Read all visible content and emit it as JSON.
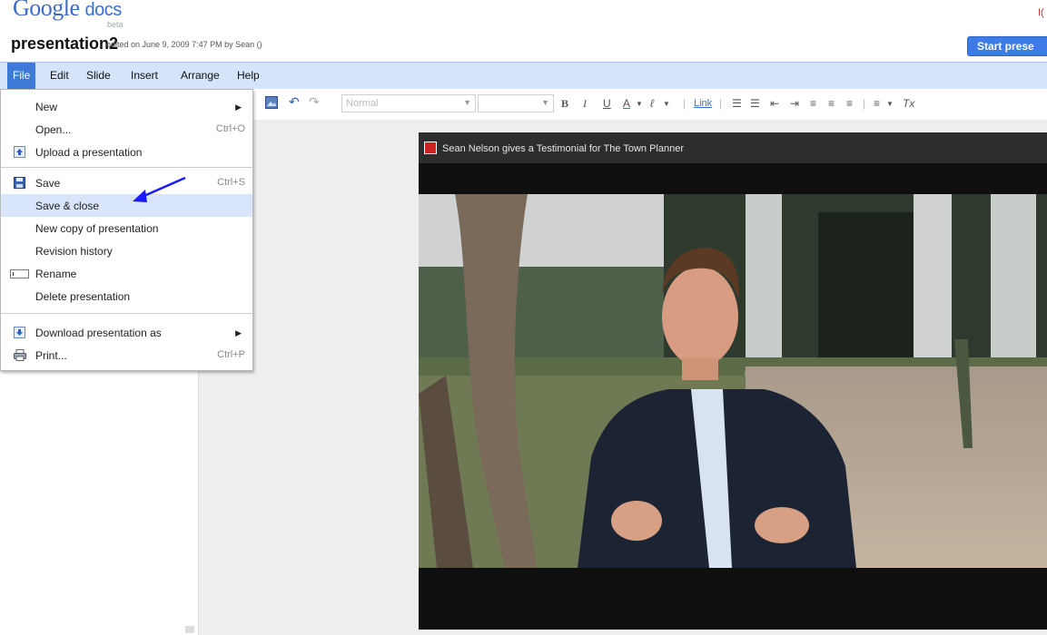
{
  "header": {
    "logo_google": "Google",
    "logo_docs": "docs",
    "beta": "beta",
    "doc_title": "presentation2",
    "edited": "edited on June 9, 2009 7:47 PM by Sean ()",
    "start_button": "Start prese",
    "top_right_link": "I("
  },
  "menubar": {
    "items": [
      {
        "label": "File"
      },
      {
        "label": "Edit"
      },
      {
        "label": "Slide"
      },
      {
        "label": "Insert"
      },
      {
        "label": "Arrange"
      },
      {
        "label": "Help"
      }
    ]
  },
  "toolbar": {
    "style_select": "Normal",
    "link": "Link",
    "bold": "B",
    "italic": "I",
    "underline": "U",
    "text_color": "A",
    "clear_format": "Tx"
  },
  "file_menu": {
    "items": [
      {
        "label": "New",
        "shortcut": "",
        "submenu": true
      },
      {
        "label": "Open...",
        "shortcut": "Ctrl+O"
      },
      {
        "label": "Upload a presentation",
        "shortcut": "",
        "icon": "upload-icon"
      },
      {
        "label": "Save",
        "shortcut": "Ctrl+S",
        "icon": "save-disk-icon"
      },
      {
        "label": "Save & close",
        "shortcut": "",
        "highlighted": true
      },
      {
        "label": "New copy of presentation",
        "shortcut": ""
      },
      {
        "label": "Revision history",
        "shortcut": ""
      },
      {
        "label": "Rename",
        "shortcut": "",
        "icon": "rename-icon"
      },
      {
        "label": "Delete presentation",
        "shortcut": ""
      },
      {
        "label": "Download presentation as",
        "shortcut": "",
        "submenu": true,
        "icon": "download-icon"
      },
      {
        "label": "Print...",
        "shortcut": "Ctrl+P",
        "icon": "printer-icon"
      }
    ]
  },
  "video": {
    "title": "Sean Nelson gives a Testimonial for The Town Planner"
  },
  "colors": {
    "menubar_bg": "#d6e4fb",
    "menu_active": "#3e7ad8",
    "start_button": "#3f7be6",
    "highlight": "#d8e5fb",
    "annotation_arrow": "#1a1aff"
  }
}
